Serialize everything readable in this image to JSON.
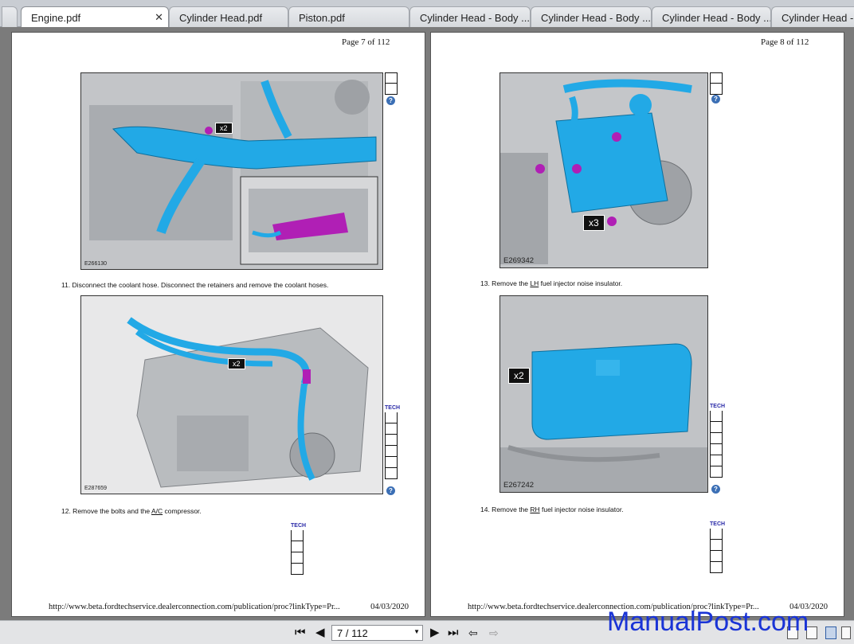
{
  "tabs": [
    {
      "label": "Engine.pdf",
      "active": true,
      "closable": true
    },
    {
      "label": "Cylinder Head.pdf",
      "active": false
    },
    {
      "label": "Piston.pdf",
      "active": false
    },
    {
      "label": "Cylinder Head - Body ...",
      "active": false
    },
    {
      "label": "Cylinder Head - Body ...",
      "active": false
    },
    {
      "label": "Cylinder Head - Body ...",
      "active": false
    },
    {
      "label": "Cylinder Head - B",
      "active": false
    }
  ],
  "left_page": {
    "page_number": "Page 7 of 112",
    "fig1_id": "E266130",
    "fig1_callout": "x2",
    "step11": "11.  Disconnect the coolant hose. Disconnect the retainers and remove the coolant hoses.",
    "fig2_id": "E287659",
    "fig2_callout": "x2",
    "step12_prefix": "12.  Remove the bolts and the ",
    "step12_link": "A/C",
    "step12_suffix": " compressor.",
    "footer_url": "http://www.beta.fordtechservice.dealerconnection.com/publication/proc?linkType=Pr...",
    "footer_date": "04/03/2020"
  },
  "right_page": {
    "page_number": "Page 8 of 112",
    "fig1_id": "E269342",
    "fig1_callout": "x3",
    "step13_prefix": "13.  Remove the ",
    "step13_link": "LH",
    "step13_suffix": " fuel injector noise insulator.",
    "fig2_id": "E267242",
    "fig2_callout": "x2",
    "step14_prefix": "14.  Remove the ",
    "step14_link": "RH",
    "step14_suffix": " fuel injector noise insulator.",
    "footer_url": "http://www.beta.fordtechservice.dealerconnection.com/publication/proc?linkType=Pr...",
    "footer_date": "04/03/2020"
  },
  "tool_header": "TECH",
  "help_icon": "?",
  "navigation": {
    "page_display": "7 / 112",
    "first_icon": "first-page-icon",
    "prev_icon": "previous-page-icon",
    "next_icon": "next-page-icon",
    "last_icon": "last-page-icon"
  },
  "watermark": "ManualPost.com",
  "colors": {
    "coolant_part": "#22a9e6",
    "highlight_part": "#b01fb5",
    "watermark": "#1a34d6",
    "engine_gray": "#b9bcbf"
  }
}
